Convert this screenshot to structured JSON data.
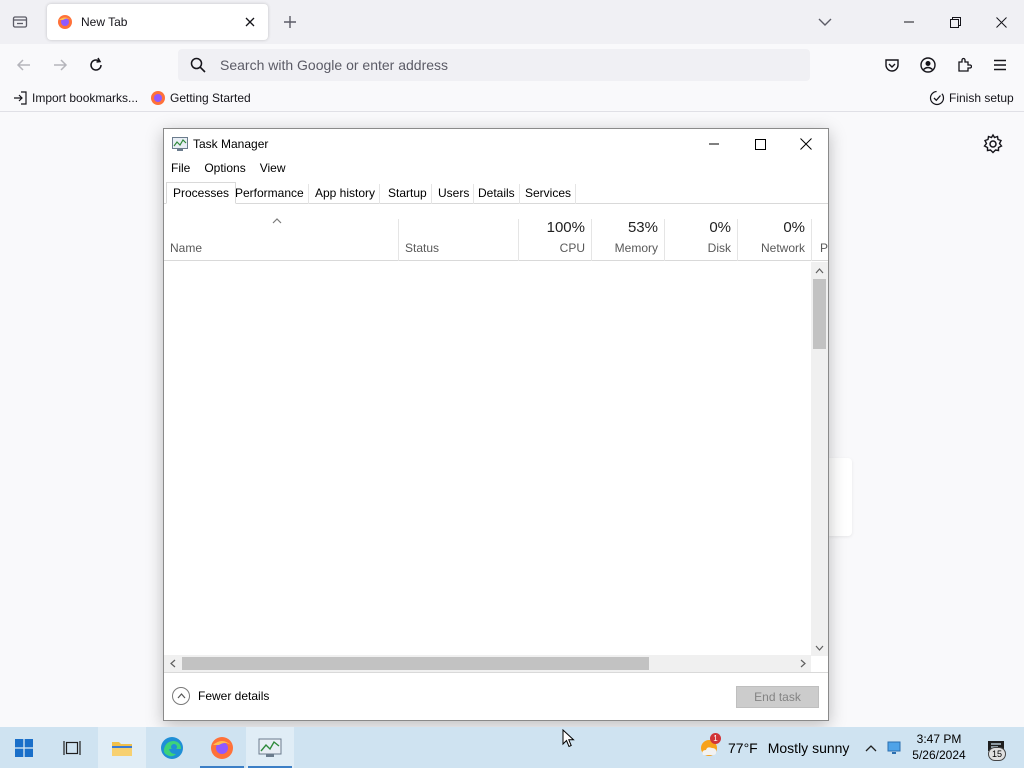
{
  "browser": {
    "tab_title": "New Tab",
    "url_placeholder": "Search with Google or enter address",
    "bookmarks": [
      "Import bookmarks...",
      "Getting Started"
    ],
    "finish_setup": "Finish setup"
  },
  "task_manager": {
    "title": "Task Manager",
    "menu": [
      "File",
      "Options",
      "View"
    ],
    "tabs": [
      "Processes",
      "Performance",
      "App history",
      "Startup",
      "Users",
      "Details",
      "Services"
    ],
    "active_tab": "Processes",
    "columns": {
      "name": "Name",
      "status": "Status",
      "cpu": {
        "pct": "100%",
        "label": "CPU"
      },
      "memory": {
        "pct": "53%",
        "label": "Memory"
      },
      "disk": {
        "pct": "0%",
        "label": "Disk"
      },
      "network": {
        "pct": "0%",
        "label": "Network"
      },
      "power": {
        "label": "P"
      }
    },
    "fewer_details": "Fewer details",
    "end_task": "End task"
  },
  "taskbar": {
    "weather_temp": "77°F",
    "weather_text": "Mostly sunny",
    "weather_badge": "1",
    "time": "3:47 PM",
    "date": "5/26/2024",
    "notification_count": "15"
  }
}
